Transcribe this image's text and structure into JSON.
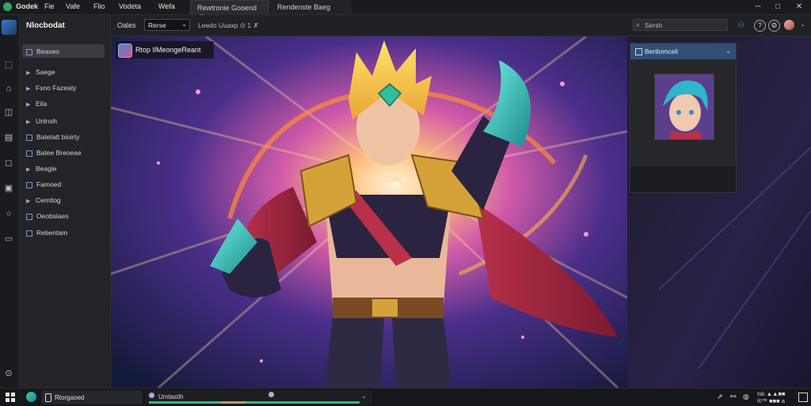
{
  "titlebar": {
    "app_name": "Godek",
    "menu": [
      "Fie",
      "Vafe",
      "Flio",
      "Vodeta",
      "Wefa"
    ],
    "tabs": [
      {
        "label": "Rewtronie Gooend",
        "close": "×",
        "active": true
      },
      {
        "label": "Rendenste Baeg",
        "active": false
      }
    ],
    "window_controls": {
      "minimize": "─",
      "maximize": "□",
      "close": "✕"
    }
  },
  "sidebar": {
    "title": "Nlocbodat",
    "items": [
      {
        "label": "Beaxeo",
        "icon": "square-icon",
        "selected": true
      },
      {
        "label": "Saege",
        "icon": "play-icon"
      },
      {
        "label": "Fsno Fazeaty",
        "icon": "play-icon"
      },
      {
        "label": "Eila",
        "icon": "play-icon"
      },
      {
        "label": "Unlroih",
        "icon": "play-icon"
      },
      {
        "label": "Batetatt bioirty",
        "icon": "square-icon"
      },
      {
        "label": "Batee Breoeae",
        "icon": "square-icon"
      },
      {
        "label": "Beagle",
        "icon": "play-icon"
      },
      {
        "label": "Famoed",
        "icon": "square-icon"
      },
      {
        "label": "Cemtlog",
        "icon": "play-icon"
      },
      {
        "label": "Oeobslaes",
        "icon": "square-icon"
      },
      {
        "label": "Rebentam",
        "icon": "square-icon"
      }
    ]
  },
  "toolbar": {
    "filter_label": "Oales",
    "filter_value": "Rerse",
    "info_text": "Leedo Uuaxp ⊙ 1 ✗",
    "search_placeholder": "Sersh"
  },
  "canvas": {
    "caption": "Rtop IlMeongeReant"
  },
  "right_panel": {
    "card_title": "Bertlomcell",
    "card_chevron": "⌄"
  },
  "taskbar": {
    "app_label": "Rtorgaoed",
    "task_label": "Umtastih",
    "tray_line1": "Isk ▲▲■■",
    "tray_line2": "®™ ■■■ a"
  },
  "colors": {
    "accent": "#2f4f75",
    "background": "#1e1f22",
    "taskbar_progress_green": "#3fb27f"
  }
}
